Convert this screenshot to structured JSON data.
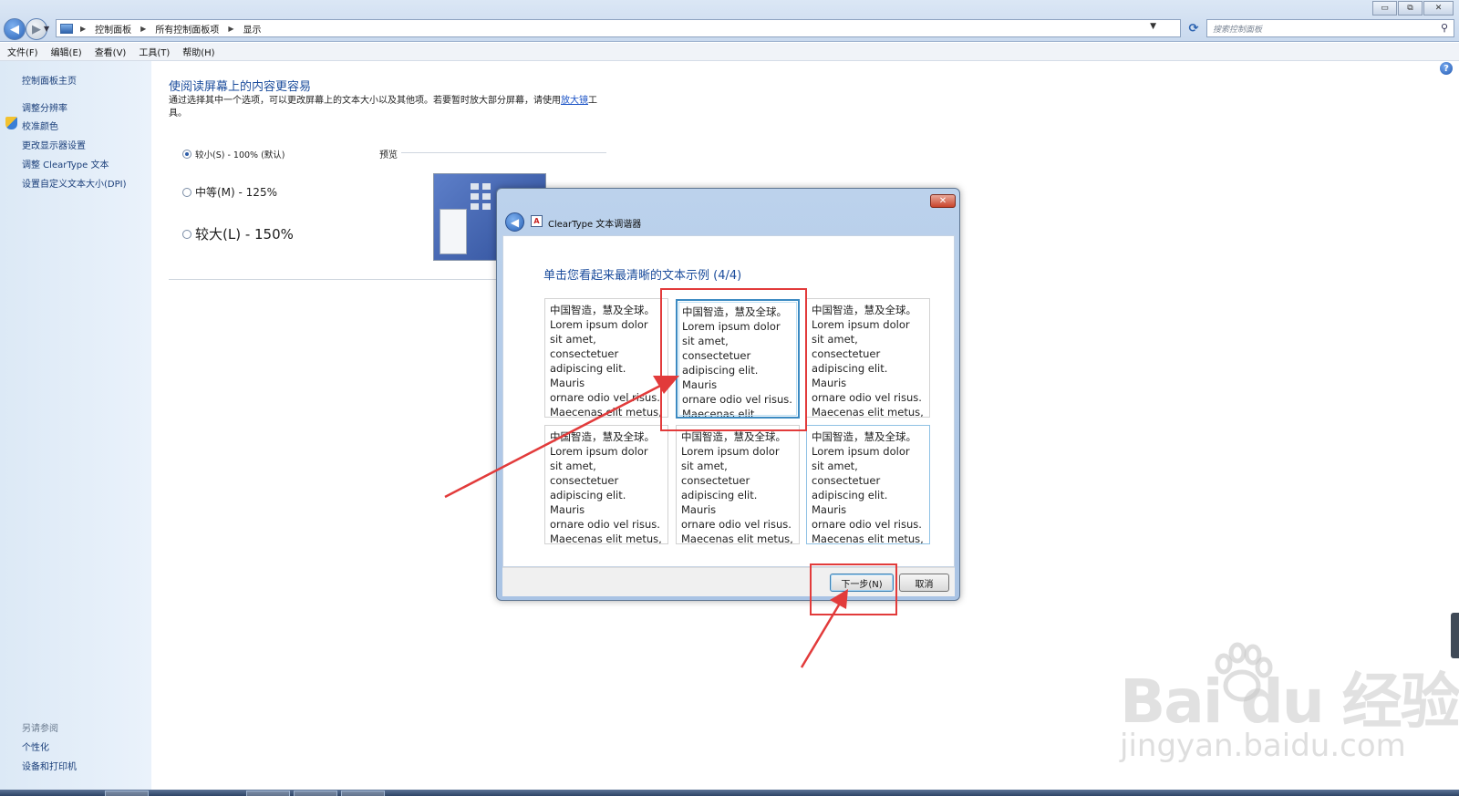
{
  "window": {
    "breadcrumbs": [
      "控制面板",
      "所有控制面板项",
      "显示"
    ],
    "search_placeholder": "搜索控制面板",
    "controls": {
      "minimize": "▭",
      "restore": "⧉",
      "close": "✕"
    }
  },
  "menu": [
    "文件(F)",
    "编辑(E)",
    "查看(V)",
    "工具(T)",
    "帮助(H)"
  ],
  "sidebar": {
    "home": "控制面板主页",
    "links": [
      "调整分辨率",
      "校准颜色",
      "更改显示器设置",
      "调整 ClearType 文本",
      "设置自定义文本大小(DPI)"
    ],
    "see_also_heading": "另请参阅",
    "see_also": [
      "个性化",
      "设备和打印机"
    ]
  },
  "main": {
    "title": "使阅读屏幕上的内容更容易",
    "description_prefix": "通过选择其中一个选项，可以更改屏幕上的文本大小以及其他项。若要暂时放大部分屏幕，请使用",
    "description_link": "放大镜",
    "description_suffix": "工具。",
    "options": [
      {
        "label": "较小(S) - 100% (默认)",
        "selected": true
      },
      {
        "label": "中等(M) - 125%",
        "selected": false
      },
      {
        "label": "较大(L) - 150%",
        "selected": false
      }
    ],
    "preview_label": "预览"
  },
  "dialog": {
    "title": "ClearType 文本调谐器",
    "close_glyph": "✕",
    "heading": "单击您看起来最清晰的文本示例 (4/4)",
    "sample_text": "中国智造，慧及全球。\nLorem ipsum dolor\nsit amet,\nconsectetuer\nadipiscing elit. Mauris\nornare odio vel risus.\nMaecenas elit metus,",
    "selected_sample": 2,
    "next_button": "下一步(N)",
    "cancel_button": "取消"
  },
  "watermark": {
    "logo": "Bai du 经验",
    "url": "jingyan.baidu.com"
  },
  "colors": {
    "annotation": "#e23b3b",
    "link": "#1b4c9c",
    "selected_border": "#3b8ac2"
  },
  "icons": [
    "back-arrow-icon",
    "forward-arrow-icon",
    "computer-icon",
    "refresh-icon",
    "search-icon",
    "shield-icon",
    "help-icon",
    "cleartype-icon",
    "close-icon"
  ]
}
